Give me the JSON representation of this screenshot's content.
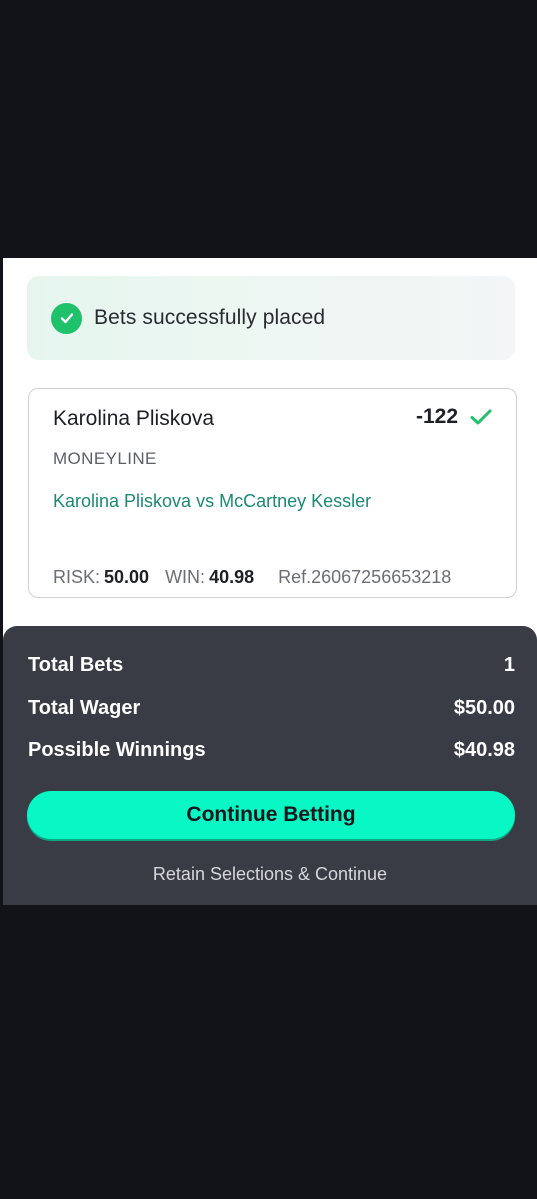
{
  "banner": {
    "message": "Bets successfully placed",
    "icon": "check-circle-icon",
    "icon_color": "#1fc16a"
  },
  "bet": {
    "selection": "Karolina Pliskova",
    "odds": "-122",
    "market": "MONEYLINE",
    "matchup": "Karolina Pliskova vs McCartney Kessler",
    "risk_label": "RISK:",
    "risk_value": "50.00",
    "win_label": "WIN:",
    "win_value": "40.98",
    "ref": "Ref.26067256653218"
  },
  "summary": {
    "total_bets_label": "Total Bets",
    "total_bets_value": "1",
    "total_wager_label": "Total Wager",
    "total_wager_value": "$50.00",
    "possible_winnings_label": "Possible Winnings",
    "possible_winnings_value": "$40.98"
  },
  "actions": {
    "continue_label": "Continue Betting",
    "retain_label": "Retain Selections & Continue",
    "accent_color": "#08f7c4"
  }
}
